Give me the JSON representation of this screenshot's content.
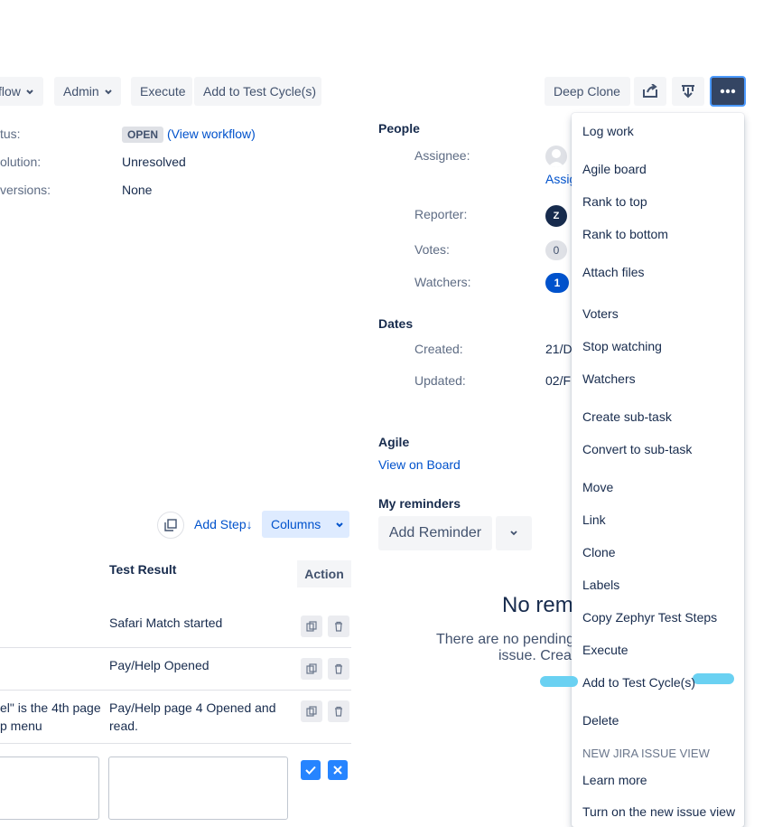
{
  "toolbar": {
    "workflow_label": "flow",
    "admin_label": "Admin",
    "execute_label": "Execute",
    "add_to_cycle_label": "Add to Test Cycle(s)",
    "deep_clone_label": "Deep Clone"
  },
  "details": {
    "status_label": "tus:",
    "status_value": "OPEN",
    "view_workflow": "(View workflow)",
    "resolution_label": "olution:",
    "resolution_value": "Unresolved",
    "versions_label": "versions:",
    "versions_value": "None"
  },
  "people": {
    "title": "People",
    "assignee_label": "Assignee:",
    "assign_link": "Assig",
    "reporter_label": "Reporter:",
    "reporter_initial": "Z",
    "votes_label": "Votes:",
    "votes_count": "0",
    "watchers_label": "Watchers:",
    "watchers_count": "1"
  },
  "dates": {
    "title": "Dates",
    "created_label": "Created:",
    "created_value": "21/D",
    "updated_label": "Updated:",
    "updated_value": "02/F"
  },
  "agile": {
    "title": "Agile",
    "view_board": "View on Board"
  },
  "reminders": {
    "title": "My reminders",
    "add_label": "Add Reminder",
    "empty_title": "No remi",
    "empty_line1": "There are no pending",
    "empty_line2": "issue. Crea"
  },
  "steps": {
    "add_step": "Add Step↓",
    "columns": "Columns",
    "col_test_result": "Test Result",
    "col_action": "Action",
    "rows": [
      {
        "step": "",
        "result": "Safari Match started"
      },
      {
        "step": "",
        "result": "Pay/Help Opened"
      },
      {
        "step_line1": "el\" is the 4th page",
        "step_line2": "p menu",
        "result_line1": "Pay/Help page 4 Opened and",
        "result_line2": "read."
      }
    ]
  },
  "menu": {
    "items": [
      "Log work",
      "Agile board",
      "Rank to top",
      "Rank to bottom",
      "Attach files",
      "Voters",
      "Stop watching",
      "Watchers",
      "Create sub-task",
      "Convert to sub-task",
      "Move",
      "Link",
      "Clone",
      "Labels",
      "Copy Zephyr Test Steps",
      "Execute",
      "Add to Test Cycle(s)",
      "Delete"
    ],
    "section_header": "NEW JIRA ISSUE VIEW",
    "learn_more": "Learn more",
    "turn_on": "Turn on the new issue view"
  },
  "colors": {
    "primary": "#0052cc",
    "more_button": "#344563",
    "highlight": "#6ad1f2"
  }
}
